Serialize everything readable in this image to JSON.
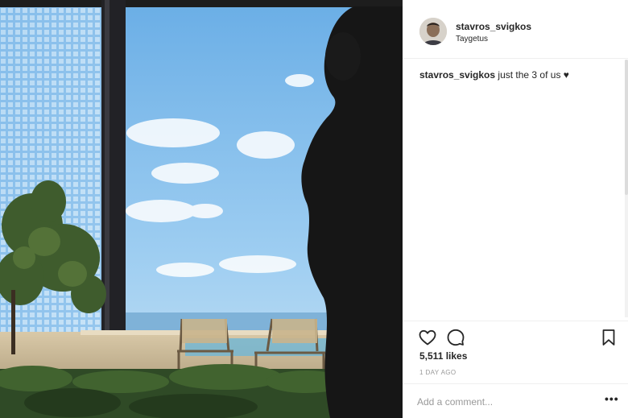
{
  "post": {
    "username": "stavros_svigkos",
    "location": "Taygetus",
    "caption_user": "stavros_svigkos",
    "caption_text": " just the 3 of us ",
    "caption_emoji": "♥",
    "likes": "5,511 likes",
    "time": "1 DAY AGO",
    "comment_placeholder": "Add a comment...",
    "more_label": "•••"
  },
  "icons": {
    "like": "heart-outline-icon",
    "comment": "speech-bubble-icon",
    "save": "bookmark-icon",
    "more": "ellipsis-icon"
  },
  "colors": {
    "text": "#262626",
    "muted": "#999999",
    "divider": "#efefef",
    "sky": "#8fc3ea"
  }
}
